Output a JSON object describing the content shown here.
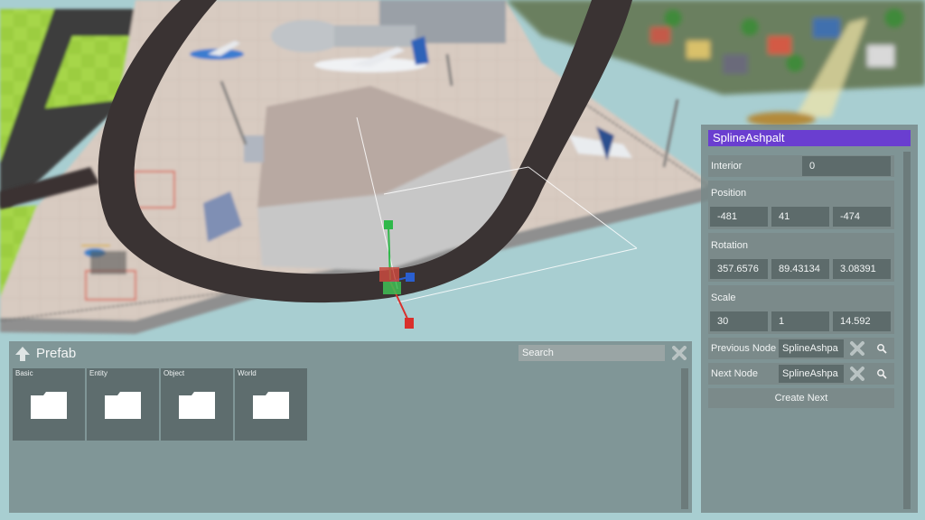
{
  "prefab": {
    "title": "Prefab",
    "search_placeholder": "Search",
    "folders": [
      {
        "label": "Basic"
      },
      {
        "label": "Entity"
      },
      {
        "label": "Object"
      },
      {
        "label": "World"
      }
    ]
  },
  "inspector": {
    "title": "SplineAshpalt",
    "interior": {
      "label": "Interior",
      "value": "0"
    },
    "position": {
      "label": "Position",
      "x": "-481",
      "y": "41",
      "z": "-474"
    },
    "rotation": {
      "label": "Rotation",
      "x": "357.6576",
      "y": "89.43134",
      "z": "3.08391"
    },
    "scale": {
      "label": "Scale",
      "x": "30",
      "y": "1",
      "z": "14.592"
    },
    "previous_node": {
      "label": "Previous Node",
      "value": "SplineAshpa"
    },
    "next_node": {
      "label": "Next Node",
      "value": "SplineAshpa"
    },
    "create_next_label": "Create Next"
  },
  "colors": {
    "panel": "#768888",
    "title_bar": "#6a3ed0",
    "field": "#5d6b6b",
    "gizmo_x": "#d9302c",
    "gizmo_y": "#2fb84a",
    "gizmo_z": "#2a5fd0"
  }
}
